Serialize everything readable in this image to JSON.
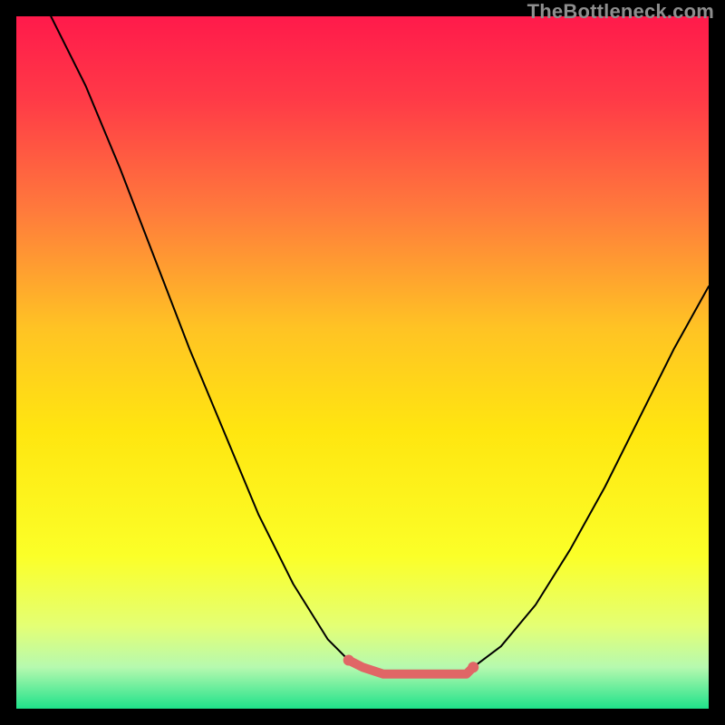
{
  "attribution": "TheBottleneck.com",
  "chart_data": {
    "type": "line",
    "title": "",
    "xlabel": "",
    "ylabel": "",
    "xlim": [
      0,
      100
    ],
    "ylim": [
      0,
      100
    ],
    "background_gradient": {
      "stops": [
        {
          "pos": 0.0,
          "color": "#ff1a4b"
        },
        {
          "pos": 0.12,
          "color": "#ff3a47"
        },
        {
          "pos": 0.28,
          "color": "#ff7a3c"
        },
        {
          "pos": 0.45,
          "color": "#ffc324"
        },
        {
          "pos": 0.6,
          "color": "#ffe610"
        },
        {
          "pos": 0.78,
          "color": "#fbff28"
        },
        {
          "pos": 0.88,
          "color": "#e4ff74"
        },
        {
          "pos": 0.94,
          "color": "#b6f9af"
        },
        {
          "pos": 1.0,
          "color": "#1fe28a"
        }
      ]
    },
    "series": [
      {
        "name": "left-curve",
        "stroke": "#000000",
        "x": [
          5,
          10,
          15,
          20,
          25,
          30,
          35,
          40,
          45,
          48,
          50
        ],
        "values": [
          100,
          90,
          78,
          65,
          52,
          40,
          28,
          18,
          10,
          7,
          6
        ]
      },
      {
        "name": "right-curve",
        "stroke": "#000000",
        "x": [
          66,
          70,
          75,
          80,
          85,
          90,
          95,
          100
        ],
        "values": [
          6,
          9,
          15,
          23,
          32,
          42,
          52,
          61
        ]
      },
      {
        "name": "floor-band",
        "stroke": "#e06666",
        "stroke_width": 10,
        "x": [
          48,
          50,
          53,
          56,
          59,
          62,
          65,
          66
        ],
        "values": [
          7,
          6,
          5,
          5,
          5,
          5,
          5,
          6
        ]
      }
    ],
    "markers": [
      {
        "name": "floor-dot-left",
        "x": 48,
        "y": 7,
        "r": 6,
        "color": "#e06666"
      },
      {
        "name": "floor-dot-right",
        "x": 66,
        "y": 6,
        "r": 6,
        "color": "#e06666"
      }
    ]
  }
}
